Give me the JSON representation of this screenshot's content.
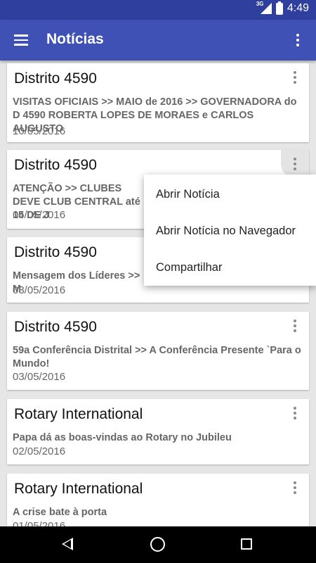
{
  "status_bar": {
    "network": "3G",
    "time": "4:49"
  },
  "app_bar": {
    "title": "Notícias"
  },
  "news": [
    {
      "source": "Distrito 4590",
      "title": "VISITAS OFICIAIS >> MAIO de 2016 >> GOVERNADORA do D 4590 ROBERTA LOPES DE MORAES e CARLOS AUGUSTO",
      "date": "10/05/2016"
    },
    {
      "source": "Distrito 4590",
      "title": "ATENÇÃO >> CLUBES DEVE CLUB CENTRAL até 15 DE J",
      "date": "04/05/2016"
    },
    {
      "source": "Distrito 4590",
      "title": "Mensagem dos Líderes >> M",
      "date": "03/05/2016"
    },
    {
      "source": "Distrito 4590",
      "title": "59a Conferência Distrital >> A Conferência Presente `Para o Mundo!",
      "date": "03/05/2016"
    },
    {
      "source": "Rotary International",
      "title": "Papa dá as boas-vindas ao Rotary no Jubileu",
      "date": "02/05/2016"
    },
    {
      "source": "Rotary International",
      "title": "A crise bate à porta",
      "date": "01/05/2016"
    }
  ],
  "popup_menu": {
    "items": [
      "Abrir Notícia",
      "Abrir Notícia no Navegador",
      "Compartilhar"
    ]
  },
  "colors": {
    "app_bar": "#3f51b5",
    "status_bar": "#2f3f9e",
    "background": "#e6e6e6"
  }
}
